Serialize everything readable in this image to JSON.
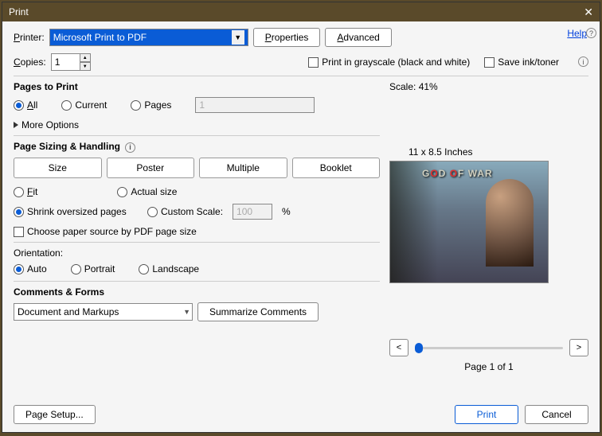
{
  "title": "Print",
  "help_label": "Help",
  "printer": {
    "label": "Printer:",
    "selected": "Microsoft Print to PDF",
    "properties_btn": "Properties",
    "advanced_btn": "Advanced"
  },
  "copies": {
    "label": "Copies:",
    "value": "1"
  },
  "options_row": {
    "grayscale": "Print in grayscale (black and white)",
    "save_ink": "Save ink/toner"
  },
  "pages_to_print": {
    "title": "Pages to Print",
    "all": "All",
    "current": "Current",
    "pages": "Pages",
    "range_value": "1",
    "more_options": "More Options"
  },
  "sizing": {
    "title": "Page Sizing & Handling",
    "size": "Size",
    "poster": "Poster",
    "multiple": "Multiple",
    "booklet": "Booklet",
    "fit": "Fit",
    "actual": "Actual size",
    "shrink": "Shrink oversized pages",
    "custom": "Custom Scale:",
    "custom_value": "100",
    "percent": "%",
    "choose_paper": "Choose paper source by PDF page size"
  },
  "orientation": {
    "title": "Orientation:",
    "auto": "Auto",
    "portrait": "Portrait",
    "landscape": "Landscape"
  },
  "comments": {
    "title": "Comments & Forms",
    "selected": "Document and Markups",
    "summarize_btn": "Summarize Comments"
  },
  "preview": {
    "scale_label": "Scale:",
    "scale_value": "41%",
    "dims": "11 x 8.5 Inches",
    "doc_title_a": "G",
    "doc_title_b": "D ",
    "doc_title_c": "O",
    "doc_title_d": "F WAR",
    "prev": "<",
    "next": ">",
    "page_of": "Page 1 of 1"
  },
  "footer": {
    "page_setup": "Page Setup...",
    "print": "Print",
    "cancel": "Cancel"
  }
}
